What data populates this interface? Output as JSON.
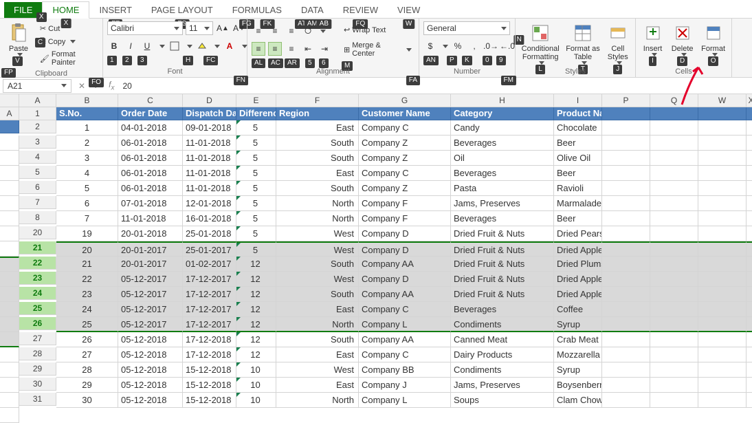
{
  "tabs": {
    "file": "FILE",
    "home": "HOME",
    "insert": "INSERT",
    "pagelayout": "PAGE LAYOUT",
    "formulas": "FORMULAS",
    "data": "DATA",
    "review": "REVIEW",
    "view": "VIEW"
  },
  "tabkeys": {
    "home": "X",
    "insert": "FF",
    "pagelayout": "FS",
    "formulas_l": "FG",
    "formulas_r": "FK",
    "data_l": "AT",
    "data_m": "AM",
    "data_r": "AB",
    "review": "FQ",
    "view": "W",
    "extra": "N"
  },
  "clipboard": {
    "paste": "Paste",
    "cut": "Cut",
    "copy": "Copy",
    "painter": "Format Painter",
    "label": "Clipboard",
    "k_paste": "V",
    "k_cut": "X",
    "k_copy": "C",
    "k_painter": "FP",
    "k_fo": "FO"
  },
  "font": {
    "name": "Calibri",
    "size": "11",
    "label": "Font",
    "bold": "B",
    "italic": "I",
    "underline": "U",
    "k1": "1",
    "k2": "2",
    "k3": "3",
    "kH": "H",
    "kFC": "FC",
    "kFN": "FN"
  },
  "align": {
    "wrap": "Wrap Text",
    "merge": "Merge & Center",
    "label": "Alignment",
    "kAL": "AL",
    "kAC": "AC",
    "kAR": "AR",
    "k5": "5",
    "k6": "6",
    "kM": "M",
    "kFA": "FA"
  },
  "number": {
    "format": "General",
    "label": "Number",
    "kAN": "AN",
    "kP": "P",
    "kK": "K",
    "k0": "0",
    "k9": "9",
    "kFM": "FM"
  },
  "styles": {
    "cond": "Conditional Formatting",
    "table": "Format as Table",
    "cell": "Cell Styles",
    "label": "Styles",
    "kL": "L",
    "kT": "T",
    "kJ": "J"
  },
  "cells": {
    "insert": "Insert",
    "delete": "Delete",
    "format": "Format",
    "label": "Cells",
    "kI": "I",
    "kD": "D",
    "kO": "O"
  },
  "namebox": "A21",
  "formula": "20",
  "columns": [
    "A",
    "B",
    "C",
    "D",
    "E",
    "F",
    "G",
    "H",
    "I",
    "P",
    "Q",
    "W",
    "X",
    "A"
  ],
  "header_row": [
    "S.No.",
    "Order Date",
    "Dispatch Date",
    "Difference",
    "Region",
    "Customer Name",
    "Category",
    "Product Name"
  ],
  "rows": [
    {
      "rn": "2",
      "d": [
        "1",
        "04-01-2018",
        "09-01-2018",
        "5",
        "East",
        "Company C",
        "Candy",
        "Chocolate"
      ],
      "sel": false
    },
    {
      "rn": "3",
      "d": [
        "2",
        "06-01-2018",
        "11-01-2018",
        "5",
        "South",
        "Company Z",
        "Beverages",
        "Beer"
      ],
      "sel": false
    },
    {
      "rn": "4",
      "d": [
        "3",
        "06-01-2018",
        "11-01-2018",
        "5",
        "South",
        "Company Z",
        "Oil",
        "Olive Oil"
      ],
      "sel": false
    },
    {
      "rn": "5",
      "d": [
        "4",
        "06-01-2018",
        "11-01-2018",
        "5",
        "East",
        "Company C",
        "Beverages",
        "Beer"
      ],
      "sel": false
    },
    {
      "rn": "6",
      "d": [
        "5",
        "06-01-2018",
        "11-01-2018",
        "5",
        "South",
        "Company Z",
        "Pasta",
        "Ravioli"
      ],
      "sel": false
    },
    {
      "rn": "7",
      "d": [
        "6",
        "07-01-2018",
        "12-01-2018",
        "5",
        "North",
        "Company F",
        "Jams, Preserves",
        "Marmalade"
      ],
      "sel": false
    },
    {
      "rn": "8",
      "d": [
        "7",
        "11-01-2018",
        "16-01-2018",
        "5",
        "North",
        "Company F",
        "Beverages",
        "Beer"
      ],
      "sel": false
    },
    {
      "rn": "20",
      "d": [
        "19",
        "20-01-2018",
        "25-01-2018",
        "5",
        "West",
        "Company D",
        "Dried Fruit & Nuts",
        "Dried Pears"
      ],
      "sel": false
    },
    {
      "rn": "21",
      "d": [
        "20",
        "20-01-2017",
        "25-01-2017",
        "5",
        "West",
        "Company D",
        "Dried Fruit & Nuts",
        "Dried Apples"
      ],
      "sel": true,
      "top": true
    },
    {
      "rn": "22",
      "d": [
        "21",
        "20-01-2017",
        "01-02-2017",
        "12",
        "South",
        "Company AA",
        "Dried Fruit & Nuts",
        "Dried Plums"
      ],
      "sel": true
    },
    {
      "rn": "23",
      "d": [
        "22",
        "05-12-2017",
        "17-12-2017",
        "12",
        "West",
        "Company D",
        "Dried Fruit & Nuts",
        "Dried Apples"
      ],
      "sel": true
    },
    {
      "rn": "24",
      "d": [
        "23",
        "05-12-2017",
        "17-12-2017",
        "12",
        "South",
        "Company AA",
        "Dried Fruit & Nuts",
        "Dried Apples"
      ],
      "sel": true
    },
    {
      "rn": "25",
      "d": [
        "24",
        "05-12-2017",
        "17-12-2017",
        "12",
        "East",
        "Company C",
        "Beverages",
        "Coffee"
      ],
      "sel": true
    },
    {
      "rn": "26",
      "d": [
        "25",
        "05-12-2017",
        "17-12-2017",
        "12",
        "North",
        "Company L",
        "Condiments",
        "Syrup"
      ],
      "sel": true,
      "bottom": true
    },
    {
      "rn": "27",
      "d": [
        "26",
        "05-12-2018",
        "17-12-2018",
        "12",
        "South",
        "Company AA",
        "Canned Meat",
        "Crab Meat"
      ],
      "sel": false
    },
    {
      "rn": "28",
      "d": [
        "27",
        "05-12-2018",
        "17-12-2018",
        "12",
        "East",
        "Company C",
        "Dairy Products",
        "Mozzarella"
      ],
      "sel": false
    },
    {
      "rn": "29",
      "d": [
        "28",
        "05-12-2018",
        "15-12-2018",
        "10",
        "West",
        "Company BB",
        "Condiments",
        "Syrup"
      ],
      "sel": false
    },
    {
      "rn": "30",
      "d": [
        "29",
        "05-12-2018",
        "15-12-2018",
        "10",
        "East",
        "Company J",
        "Jams, Preserves",
        "Boysenberry Spread"
      ],
      "sel": false
    },
    {
      "rn": "31",
      "d": [
        "30",
        "05-12-2018",
        "15-12-2018",
        "10",
        "North",
        "Company L",
        "Soups",
        "Clam Chowder"
      ],
      "sel": false
    }
  ]
}
